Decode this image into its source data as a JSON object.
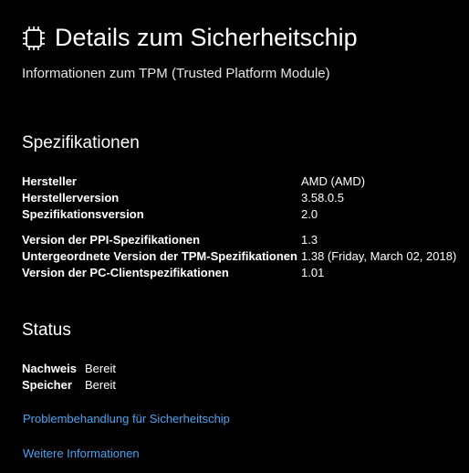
{
  "header": {
    "icon": "chip-icon",
    "title": "Details zum Sicherheitschip",
    "subtitle": "Informationen zum TPM (Trusted Platform Module)"
  },
  "specifications": {
    "title": "Spezifikationen",
    "rows": [
      {
        "label": "Hersteller",
        "value": "AMD (AMD)"
      },
      {
        "label": "Herstellerversion",
        "value": "3.58.0.5"
      },
      {
        "label": "Spezifikationsversion",
        "value": "2.0"
      },
      {
        "label": "Version der PPI-Spezifikationen",
        "value": "1.3"
      },
      {
        "label": "Untergeordnete Version der TPM-Spezifikationen",
        "value": "1.38 (Friday, March 02, 2018)"
      },
      {
        "label": "Version der PC-Clientspezifikationen",
        "value": "1.01"
      }
    ]
  },
  "status": {
    "title": "Status",
    "rows": [
      {
        "label": "Nachweis",
        "value": "Bereit"
      },
      {
        "label": "Speicher",
        "value": "Bereit"
      }
    ]
  },
  "links": {
    "troubleshoot": "Problembehandlung für Sicherheitschip",
    "more_info": "Weitere Informationen"
  },
  "colors": {
    "background": "#000000",
    "text": "#ffffff",
    "link": "#4aa3f0"
  }
}
